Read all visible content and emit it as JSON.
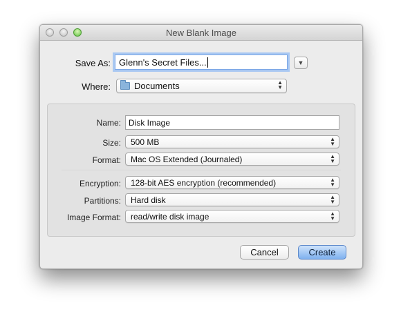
{
  "window": {
    "title": "New Blank Image"
  },
  "save_as": {
    "label": "Save As:",
    "value": "Glenn's Secret Files..."
  },
  "where": {
    "label": "Where:",
    "value": "Documents"
  },
  "fields": {
    "name": {
      "label": "Name:",
      "value": "Disk Image"
    },
    "size": {
      "label": "Size:",
      "value": "500 MB"
    },
    "format": {
      "label": "Format:",
      "value": "Mac OS Extended (Journaled)"
    },
    "encryption": {
      "label": "Encryption:",
      "value": "128-bit AES encryption (recommended)"
    },
    "partitions": {
      "label": "Partitions:",
      "value": "Hard disk"
    },
    "image_format": {
      "label": "Image Format:",
      "value": "read/write disk image"
    }
  },
  "buttons": {
    "cancel": "Cancel",
    "create": "Create"
  },
  "icons": {
    "traffic_lights": [
      "close-icon",
      "minimize-icon",
      "zoom-icon"
    ],
    "expand": "chevron-down-icon",
    "folder": "folder-icon",
    "popup_arrows": "up-down-arrows-icon"
  },
  "colors": {
    "accent": "#7fb1ef",
    "focus_ring": "#a9c8f2"
  }
}
